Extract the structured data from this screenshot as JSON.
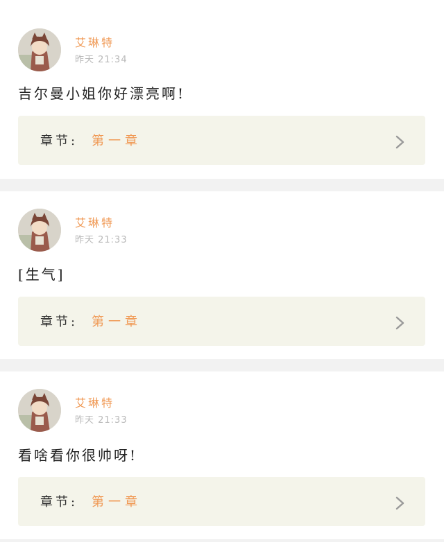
{
  "header": {
    "active_tab_color": "#e8739a"
  },
  "comments": [
    {
      "avatar_icon": "user-avatar",
      "user_name": "艾琳特",
      "timestamp": "昨天 21:34",
      "text": "吉尔曼小姐你好漂亮啊!",
      "chapter_label": "章节:",
      "chapter_value": "第一章"
    },
    {
      "avatar_icon": "user-avatar",
      "user_name": "艾琳特",
      "timestamp": "昨天 21:33",
      "text": "[生气]",
      "chapter_label": "章节:",
      "chapter_value": "第一章"
    },
    {
      "avatar_icon": "user-avatar",
      "user_name": "艾琳特",
      "timestamp": "昨天 21:33",
      "text": "看啥看你很帅呀!",
      "chapter_label": "章节:",
      "chapter_value": "第一章"
    }
  ],
  "colors": {
    "accent": "#f09a56",
    "timestamp": "#b8b8b8",
    "chapter_bg": "#f4f4ea",
    "separator": "#f2f2f2"
  }
}
